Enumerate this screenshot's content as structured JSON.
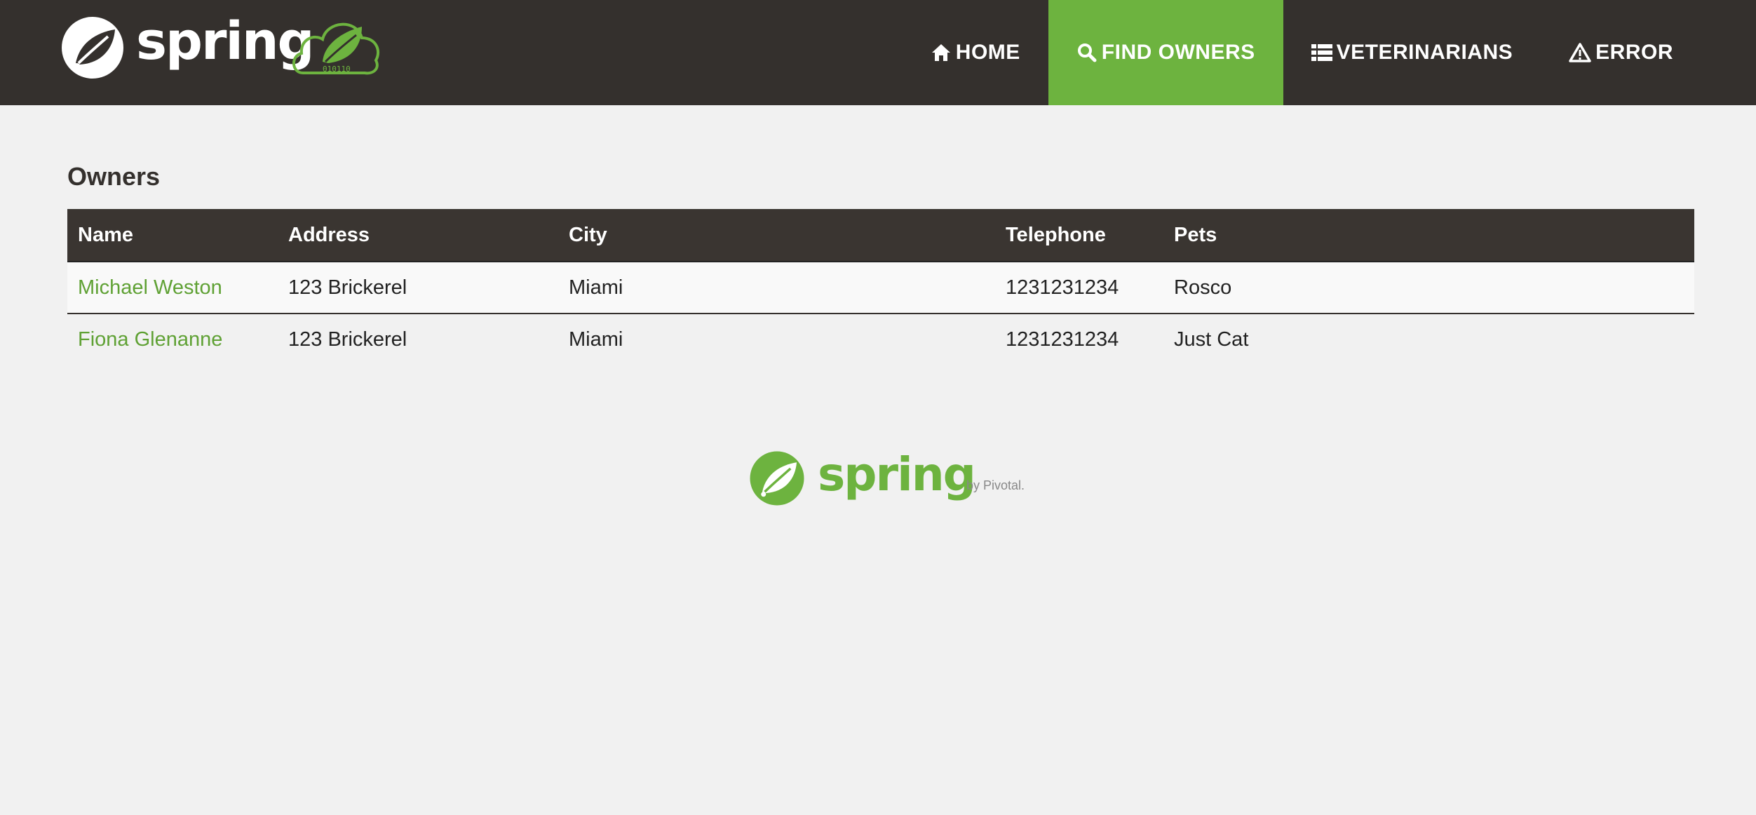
{
  "brand": {
    "wordmark": "spring",
    "cloud_badge_text": "010110"
  },
  "nav": {
    "items": [
      {
        "label": "HOME",
        "icon": "home-icon",
        "active": false
      },
      {
        "label": "FIND OWNERS",
        "icon": "search-icon",
        "active": true
      },
      {
        "label": "VETERINARIANS",
        "icon": "list-icon",
        "active": false
      },
      {
        "label": "ERROR",
        "icon": "warning-icon",
        "active": false
      }
    ]
  },
  "page": {
    "title": "Owners"
  },
  "table": {
    "columns": [
      "Name",
      "Address",
      "City",
      "Telephone",
      "Pets"
    ],
    "rows": [
      {
        "name": "Michael Weston",
        "address": "123 Brickerel",
        "city": "Miami",
        "telephone": "1231231234",
        "pets": "Rosco"
      },
      {
        "name": "Fiona Glenanne",
        "address": "123 Brickerel",
        "city": "Miami",
        "telephone": "1231231234",
        "pets": "Just Cat"
      }
    ]
  },
  "footer": {
    "wordmark": "spring",
    "byline": "by Pivotal."
  },
  "colors": {
    "nav_bg": "#34302d",
    "accent": "#6db33f",
    "link": "#5fa134",
    "page_bg": "#f1f1f1"
  }
}
